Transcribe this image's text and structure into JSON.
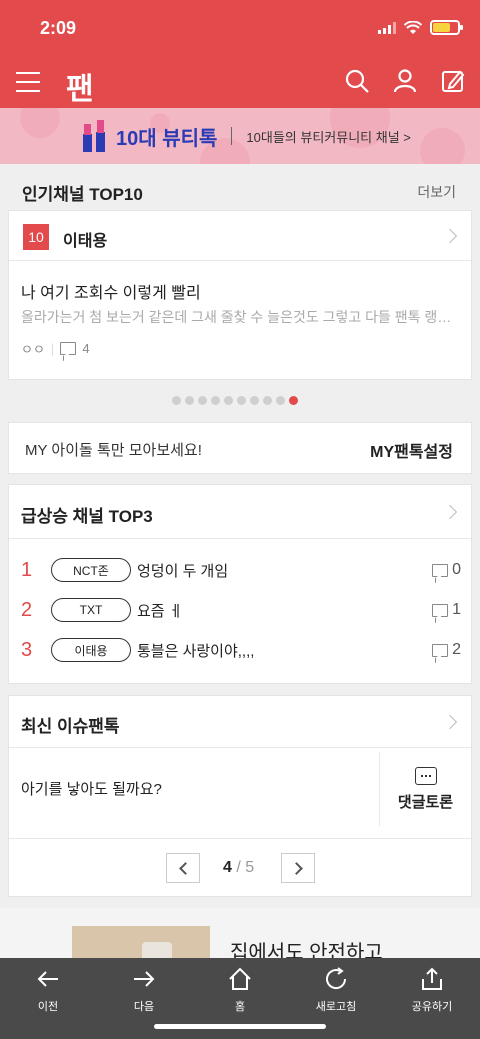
{
  "status": {
    "time": "2:09"
  },
  "header": {
    "logo": "팬"
  },
  "banner": {
    "title": "10대 뷰티톡",
    "subtitle": "10대들의 뷰티커뮤니티 채널 >"
  },
  "popular": {
    "title": "인기채널 TOP10",
    "more": "더보기",
    "rank": "10",
    "channel": "이태용",
    "post_title": "나 여기 조회수 이렇게 빨리",
    "post_preview": "올라가는거 첨 보는거 같은데 그새 줄찾 수 늘은것도 그렇고 다들 팬톡 랭킹...",
    "reactions": "ㅇㅇ",
    "comments": "4",
    "page_count": 10,
    "active_page": 10
  },
  "my_idol": {
    "text": "MY 아이돌 톡만 모아보세요!",
    "button": "MY팬톡설정"
  },
  "rising": {
    "title": "급상승 채널 TOP3",
    "items": [
      {
        "rank": "1",
        "tag": "NCT존",
        "title": "엉덩이 두 개임",
        "comments": "0"
      },
      {
        "rank": "2",
        "tag": "TXT",
        "title": "요즘 ㅔ",
        "comments": "1"
      },
      {
        "rank": "3",
        "tag": "이태용",
        "title": "통블은 사랑이야,,,,",
        "comments": "2"
      }
    ]
  },
  "issue": {
    "title": "최신 이슈팬톡",
    "question": "아기를 낳아도 될까요?",
    "debate_label": "댓글토론",
    "page_current": "4",
    "page_sep": "/",
    "page_total": "5"
  },
  "ad": {
    "text": "집에서도 안전하고"
  },
  "bottom_nav": [
    {
      "label": "이전",
      "icon": "back-arrow-icon"
    },
    {
      "label": "다음",
      "icon": "forward-arrow-icon"
    },
    {
      "label": "홈",
      "icon": "home-icon"
    },
    {
      "label": "새로고침",
      "icon": "refresh-icon"
    },
    {
      "label": "공유하기",
      "icon": "share-icon"
    }
  ]
}
